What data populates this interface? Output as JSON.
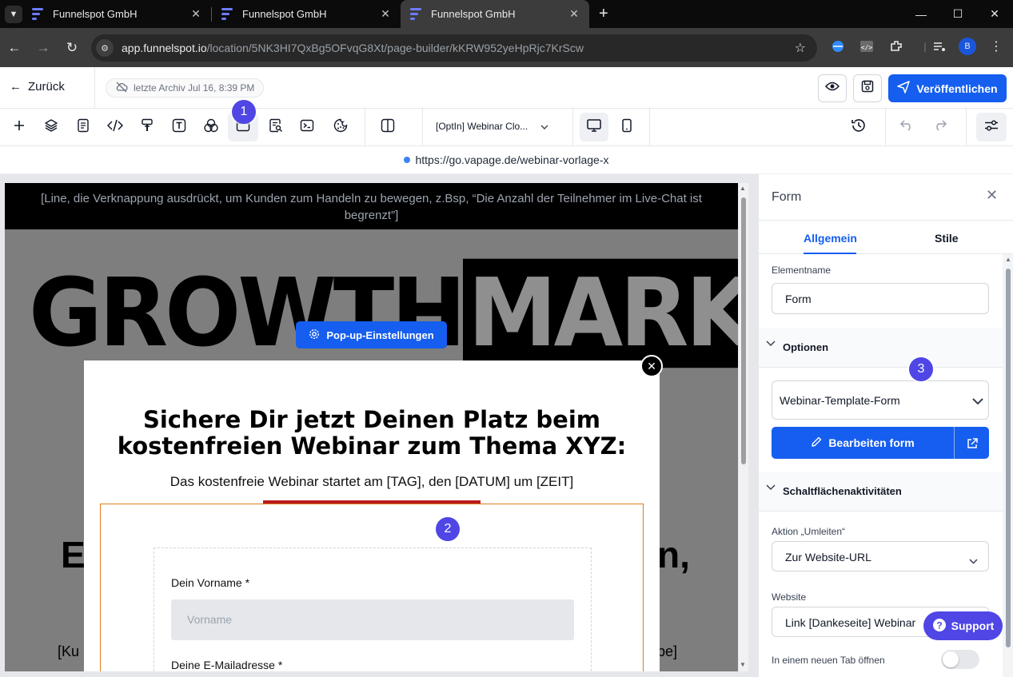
{
  "browser": {
    "tabs": [
      {
        "title": "Funnelspot GmbH",
        "active": false
      },
      {
        "title": "Funnelspot GmbH",
        "active": false
      },
      {
        "title": "Funnelspot GmbH",
        "active": true
      }
    ],
    "url_host": "app.funnelspot.io",
    "url_path": "/location/5NK3HI7QxBg5OFvqG8Xt/page-builder/kKRW952yeHpRjc7KrScw",
    "profile_initial": "B"
  },
  "header": {
    "back_label": "Zurück",
    "archive_label": "letzte Archiv Jul 16, 8:39 PM",
    "publish_label": "Veröffentlichen"
  },
  "toolbar": {
    "page_select": "[OptIn] Webinar Clo...",
    "badge_1": "1"
  },
  "preview_url": "https://go.vapage.de/webinar-vorlage-x",
  "canvas": {
    "scarcity_text": "[Line, die Verknappung ausdrückt, um Kunden zum Handeln zu bewegen, z.Bsp, “Die Anzahl der Teilnehmer im Live-Chat ist begrenzt”]",
    "logo_part1": "GROWTH",
    "logo_part2": "MARKETER",
    "big_headline_left": "Er",
    "big_headline_right": "n,",
    "bottom_text_left": "[Ku",
    "bottom_text_right": "ppe]",
    "popup_settings_label": "Pop-up-Einstellungen",
    "popup": {
      "headline": "Sichere Dir jetzt Deinen Platz beim kostenfreien Webinar zum Thema XYZ:",
      "subline": "Das kostenfreie Webinar startet am [TAG], den [DATUM] um [ZEIT]",
      "badge_2": "2",
      "form": {
        "firstname_label": "Dein Vorname *",
        "firstname_placeholder": "Vorname",
        "email_label": "Deine E-Mailadresse *"
      }
    }
  },
  "panel": {
    "title": "Form",
    "tabs": [
      {
        "label": "Allgemein",
        "active": true
      },
      {
        "label": "Stile",
        "active": false
      }
    ],
    "element_name_label": "Elementname",
    "element_name_value": "Form",
    "options_section": "Optionen",
    "badge_3": "3",
    "form_select_value": "Webinar-Template-Form",
    "edit_form_label": "Bearbeiten form",
    "button_actions_section": "Schaltflächenaktivitäten",
    "action_label": "Aktion „Umleiten“",
    "action_value": "Zur Website-URL",
    "website_label": "Website",
    "website_value": "Link [Dankeseite] Webinar",
    "new_tab_label": "In einem neuen Tab öffnen",
    "support_label": "Support"
  },
  "colors": {
    "primary": "#155eef",
    "badge": "#4f46e5",
    "form_border": "#e07b1a",
    "accent_bar": "#b91c1c"
  }
}
